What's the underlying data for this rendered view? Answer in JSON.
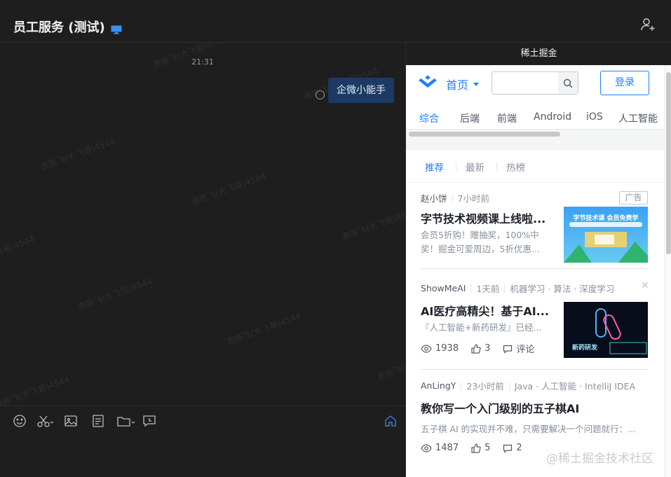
{
  "chat": {
    "title": "员工服务 (测试)",
    "timestamp": "21:31",
    "bubble_text": "企微小能手"
  },
  "watermark": {
    "text": "表陈飞(大飞哥)4544"
  },
  "panel": {
    "title": "稀土掘金",
    "nav": {
      "home_label": "首页",
      "search_placeholder": "",
      "login_label": "登录"
    },
    "categories": [
      "综合",
      "后端",
      "前端",
      "Android",
      "iOS",
      "人工智能"
    ],
    "sort_tabs": [
      "推荐",
      "最新",
      "热榜"
    ],
    "entries": [
      {
        "author": "赵小饼",
        "time": "7小时前",
        "badge": "广告",
        "title": "字节技术视频课上线啦...",
        "abstract_lines": [
          "会员5折购！赠抽奖，100%中",
          "奖！掘金可爱周边，5折优惠..."
        ],
        "thumb_caption": "字节技术课 会员免费学"
      },
      {
        "author": "ShowMeAI",
        "time": "1天前",
        "tags": "机器学习 · 算法 · 深度学习",
        "title": "AI医疗高精尖！基于AI...",
        "abstract_lines": [
          "『人工智能+新药研发』已经..."
        ],
        "views": "1938",
        "likes": "3",
        "comments": "评论",
        "thumb_caption": "新药研发"
      },
      {
        "author": "AnLingY",
        "time": "23小时前",
        "tags": "Java · 人工智能 · IntelliJ IDEA",
        "title": "教你写一个入门级别的五子棋AI",
        "abstract_lines": [
          "五子棋 AI 的实现并不难，只需要解决一个问题就行：..."
        ],
        "views": "1487",
        "likes": "5",
        "comments": "2"
      }
    ]
  },
  "credit": "@稀土掘金技术社区"
}
